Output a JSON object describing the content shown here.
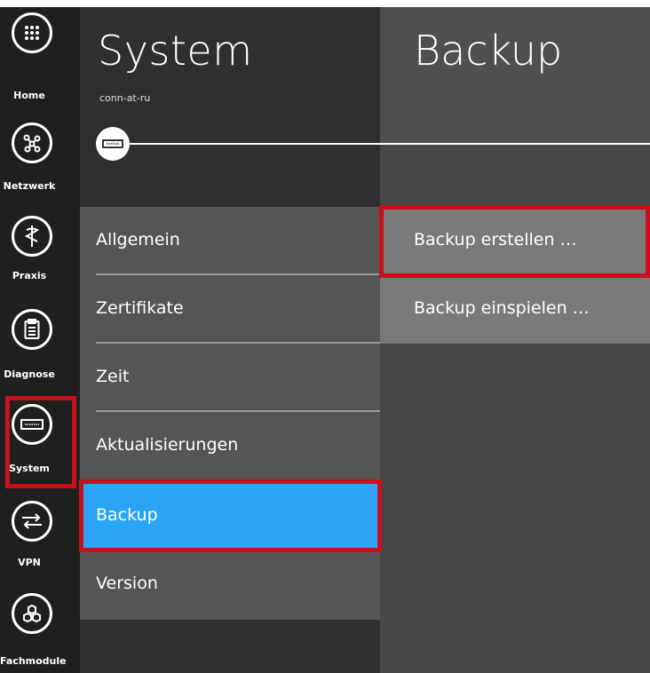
{
  "rail": {
    "items": [
      {
        "label": "Home",
        "icon": "grid-icon"
      },
      {
        "label": "Netzwerk",
        "icon": "network-icon"
      },
      {
        "label": "Praxis",
        "icon": "caduceus-icon"
      },
      {
        "label": "Diagnose",
        "icon": "clipboard-icon"
      },
      {
        "label": "System",
        "icon": "device-icon"
      },
      {
        "label": "VPN",
        "icon": "vpn-icon"
      },
      {
        "label": "Fachmodule",
        "icon": "modules-icon"
      }
    ]
  },
  "system": {
    "title": "System",
    "subtitle": "conn-at-ru",
    "menu": [
      {
        "label": "Allgemein"
      },
      {
        "label": "Zertifikate"
      },
      {
        "label": "Zeit"
      },
      {
        "label": "Aktualisierungen"
      },
      {
        "label": "Backup"
      },
      {
        "label": "Version"
      }
    ]
  },
  "backup": {
    "title": "Backup",
    "actions": [
      {
        "label": "Backup erstellen …"
      },
      {
        "label": "Backup einspielen …"
      }
    ]
  },
  "colors": {
    "active": "#2aa5f5",
    "highlight": "#c8101c"
  }
}
